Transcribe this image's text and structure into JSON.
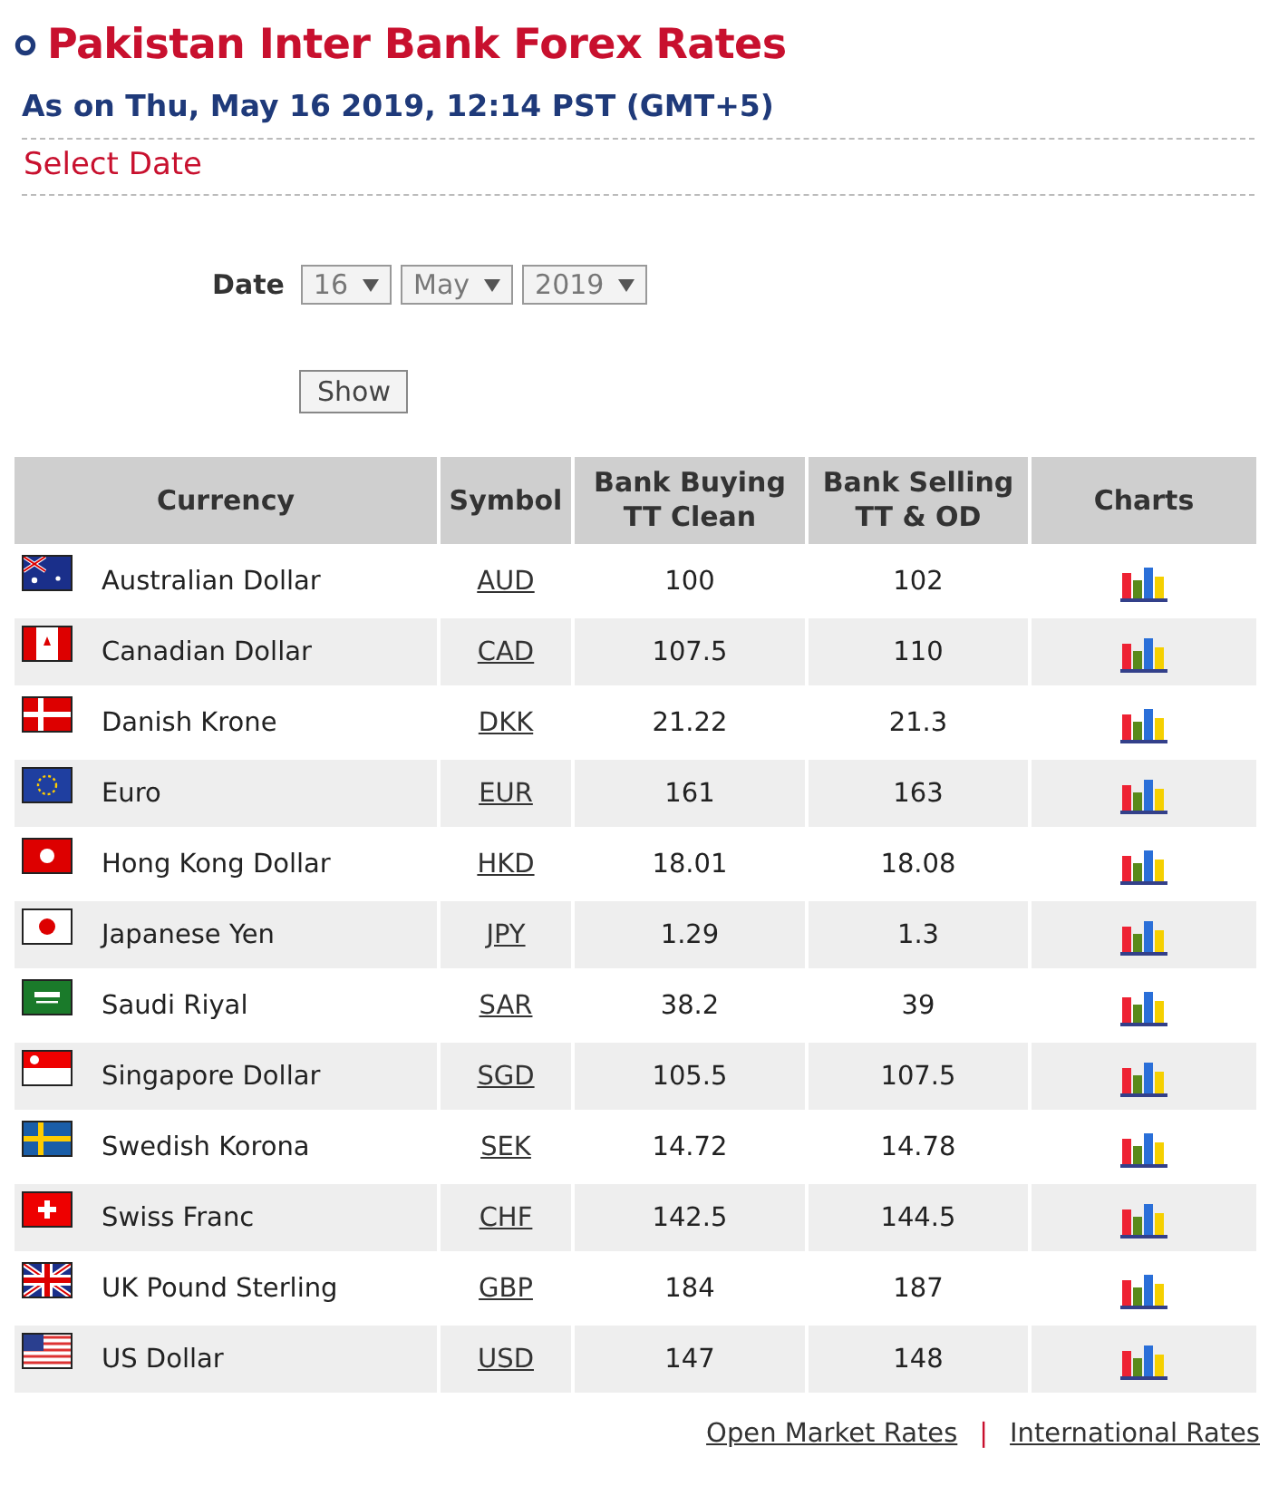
{
  "title": "Pakistan Inter Bank Forex Rates",
  "subtitle": "As on Thu, May 16 2019, 12:14 PST (GMT+5)",
  "section_title": "Select Date",
  "date_form": {
    "label": "Date",
    "day": "16",
    "month": "May",
    "year": "2019",
    "button": "Show"
  },
  "table": {
    "columns": [
      "Currency",
      "Symbol",
      "Bank Buying TT Clean",
      "Bank Selling TT & OD",
      "Charts"
    ],
    "rows": [
      {
        "currency": "Australian Dollar",
        "symbol": "AUD",
        "buying": "100",
        "selling": "102"
      },
      {
        "currency": "Canadian Dollar",
        "symbol": "CAD",
        "buying": "107.5",
        "selling": "110"
      },
      {
        "currency": "Danish Krone",
        "symbol": "DKK",
        "buying": "21.22",
        "selling": "21.3"
      },
      {
        "currency": "Euro",
        "symbol": "EUR",
        "buying": "161",
        "selling": "163"
      },
      {
        "currency": "Hong Kong Dollar",
        "symbol": "HKD",
        "buying": "18.01",
        "selling": "18.08"
      },
      {
        "currency": "Japanese Yen",
        "symbol": "JPY",
        "buying": "1.29",
        "selling": "1.3"
      },
      {
        "currency": "Saudi Riyal",
        "symbol": "SAR",
        "buying": "38.2",
        "selling": "39"
      },
      {
        "currency": "Singapore Dollar",
        "symbol": "SGD",
        "buying": "105.5",
        "selling": "107.5"
      },
      {
        "currency": "Swedish Korona",
        "symbol": "SEK",
        "buying": "14.72",
        "selling": "14.78"
      },
      {
        "currency": "Swiss Franc",
        "symbol": "CHF",
        "buying": "142.5",
        "selling": "144.5"
      },
      {
        "currency": "UK Pound Sterling",
        "symbol": "GBP",
        "buying": "184",
        "selling": "187"
      },
      {
        "currency": "US Dollar",
        "symbol": "USD",
        "buying": "147",
        "selling": "148"
      }
    ]
  },
  "footer_links": [
    {
      "label": "Open Market Rates"
    },
    {
      "label": "International Rates"
    }
  ],
  "footer_separator": "|"
}
